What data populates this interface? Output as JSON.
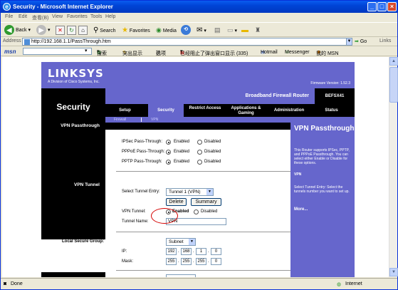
{
  "window": {
    "title": "Security - Microsoft Internet Explorer"
  },
  "menu": [
    "File",
    "Edit",
    "查看(B)",
    "View",
    "Favorites",
    "Tools",
    "Help"
  ],
  "toolbar": {
    "back": "Back",
    "search": "Search",
    "favorites": "Favorites",
    "media": "Media"
  },
  "address": {
    "label": "Address",
    "url": "http://192.168.1.1/PassThrough.htm",
    "go": "Go",
    "links": "Links"
  },
  "msn": {
    "logo": "msn",
    "search": "搜索",
    "highlight": "突出显示",
    "options": "选项",
    "popup": "已经阻止了弹出窗口显示 (335)",
    "hotmail": "Hotmail",
    "messenger": "Messenger",
    "mymsn": "我的 MSN"
  },
  "page": {
    "logo": "LINKSYS",
    "logo_sub": "A Division of Cisco Systems, Inc.",
    "firmware": "Firmware Version: 1.52.3",
    "section": "Security",
    "product": "Broadband Firewall Router",
    "model": "BEFSX41",
    "tabs": [
      "Setup",
      "Security",
      "Restrict Access",
      "Applications & Gaming",
      "Administration",
      "Status"
    ],
    "subtabs": [
      "Firewall",
      "VPN"
    ],
    "left": {
      "vpn_passthrough": "VPN Passthrough",
      "vpn_tunnel": "VPN Tunnel",
      "local_secure": "Local Secure Group:"
    },
    "ipsec": {
      "label": "IPSec Pass-Through:",
      "enabled": "Enabled",
      "disabled": "Disabled"
    },
    "pppoe": {
      "label": "PPPoE Pass-Through:",
      "enabled": "Enabled",
      "disabled": "Disabled"
    },
    "pptp": {
      "label": "PPTP Pass-Through:",
      "enabled": "Enabled",
      "disabled": "Disabled"
    },
    "tunnel_entry": {
      "label": "Select Tunnel Entry:",
      "value": "Tunnel 1   (VPN)",
      "delete": "Delete",
      "summary": "Summary"
    },
    "vpn_tunnel": {
      "label": "VPN Tunnel:",
      "enabled": "Enabled",
      "disabled": "Disabled"
    },
    "tunnel_name": {
      "label": "Tunnel Name:",
      "value": "VPN"
    },
    "local_group": {
      "type": "Subnet",
      "ip_label": "IP:",
      "mask_label": "Mask:",
      "ip": [
        "192",
        "168",
        "1",
        "0"
      ],
      "mask": [
        "255",
        "255",
        "255",
        "0"
      ]
    },
    "help": {
      "title": "VPN Passthrough",
      "p1": "This Router supports IPSec, PPTP, and PPPoE Passthrough. You can select either Enable or Disable for these options.",
      "h2": "VPN",
      "p2": "Select Tunnel Entry: Select the tunnels number you want to set up.",
      "more": "More..."
    }
  },
  "status": {
    "done": "Done",
    "zone": "Internet"
  }
}
